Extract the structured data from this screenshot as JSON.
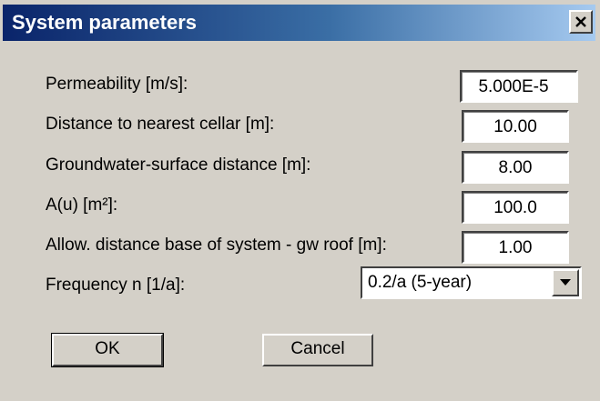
{
  "window": {
    "title": "System parameters"
  },
  "params": [
    {
      "label": "Permeability [m/s]:",
      "value": "5.000E-5"
    },
    {
      "label": "Distance to nearest cellar [m]:",
      "value": "10.00"
    },
    {
      "label": "Groundwater-surface distance [m]:",
      "value": "8.00"
    },
    {
      "label": "A(u) [m²]:",
      "value": "100.0"
    },
    {
      "label": "Allow. distance base of system - gw roof [m]:",
      "value": "1.00"
    }
  ],
  "frequency": {
    "label": "Frequency n [1/a]:",
    "selected": "0.2/a (5-year)"
  },
  "buttons": {
    "ok": "OK",
    "cancel": "Cancel"
  },
  "icons": {
    "close": "close-icon",
    "dropdown": "chevron-down-icon"
  }
}
